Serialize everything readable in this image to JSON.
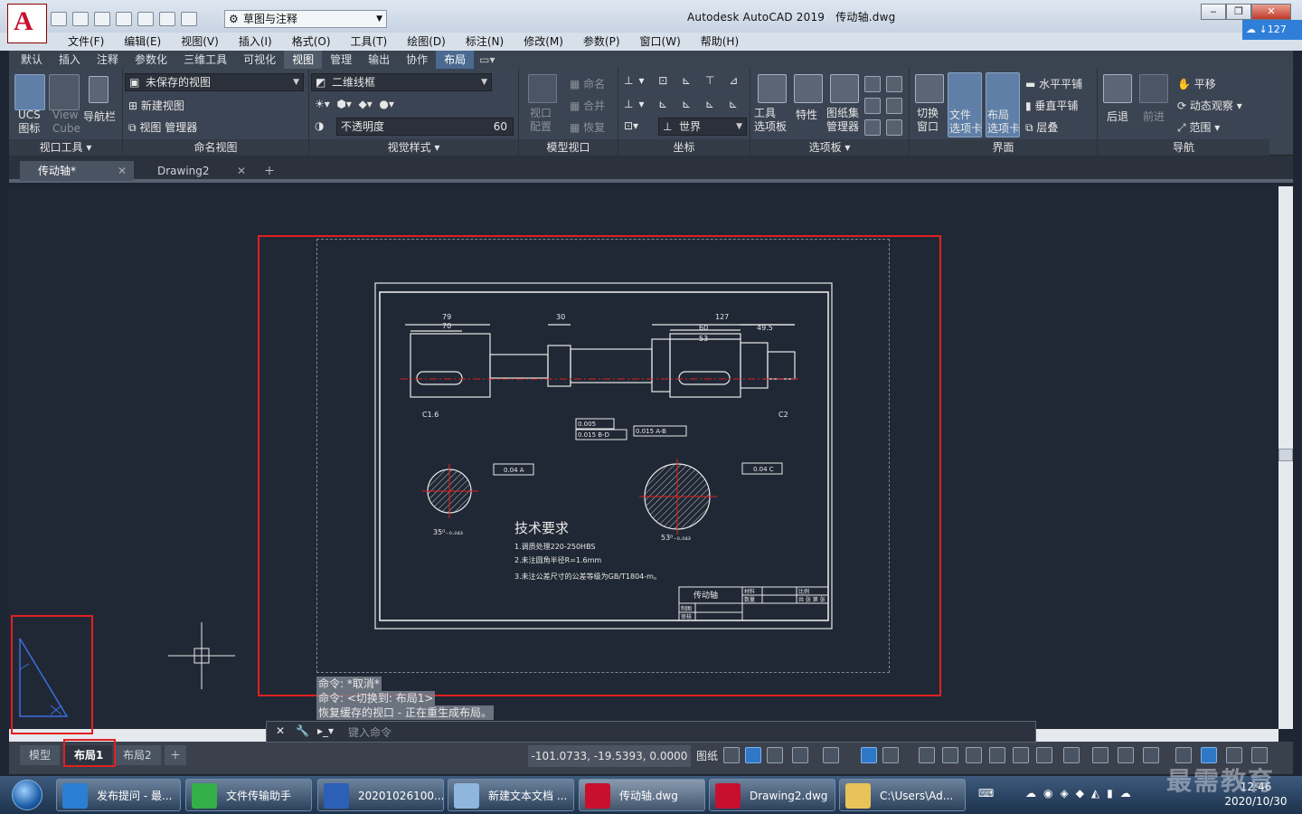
{
  "app": {
    "title": "Autodesk AutoCAD 2019",
    "filename": "传动轴.dwg",
    "workspace": "草图与注释",
    "cloud_badge": "127"
  },
  "menus": [
    "文件(F)",
    "编辑(E)",
    "视图(V)",
    "插入(I)",
    "格式(O)",
    "工具(T)",
    "绘图(D)",
    "标注(N)",
    "修改(M)",
    "参数(P)",
    "窗口(W)",
    "帮助(H)"
  ],
  "ribbon_tabs": [
    "默认",
    "插入",
    "注释",
    "参数化",
    "三维工具",
    "可视化",
    "视图",
    "管理",
    "输出",
    "协作",
    "布局"
  ],
  "ribbon": {
    "viewport_tools": {
      "label": "视口工具",
      "ucs": "UCS\n图标",
      "viewcube": "View\nCube",
      "navbar": "导航栏"
    },
    "named_views": {
      "label": "命名视图",
      "dropdown": "未保存的视图",
      "new_view": "新建视图",
      "view_manager": "视图 管理器"
    },
    "visual_styles": {
      "label": "视觉样式",
      "dropdown": "二维线框",
      "opacity_placeholder": "不透明度",
      "opacity_value": "60"
    },
    "model_viewports": {
      "label": "模型视口",
      "config": "视口\n配置",
      "name": "命名",
      "join": "合并",
      "restore": "恢复"
    },
    "coordinates": {
      "label": "坐标",
      "world": "世界"
    },
    "palettes": {
      "label": "选项板",
      "tool": "工具\n选项板",
      "properties": "特性",
      "sheetset": "图纸集\n管理器"
    },
    "interface": {
      "label": "界面",
      "switch": "切换\n窗口",
      "file_tabs": "文件\n选项卡",
      "layout_tabs": "布局\n选项卡",
      "tile_h": "水平平铺",
      "tile_v": "垂直平铺",
      "cascade": "层叠"
    },
    "navigate": {
      "label": "导航",
      "back": "后退",
      "forward": "前进",
      "pan": "平移",
      "orbit": "动态观察",
      "extents": "范围"
    }
  },
  "doc_tabs": [
    {
      "label": "传动轴*",
      "active": true
    },
    {
      "label": "Drawing2",
      "active": false
    }
  ],
  "drawing": {
    "dims": [
      "79",
      "70",
      "30",
      "127",
      "60",
      "49.5",
      "53",
      "C1.6",
      "C2"
    ],
    "tech_title": "技术要求",
    "tech_lines": [
      "1.调质处理220-250HBS",
      "2.未注圆角半径R=1.6mm",
      "3.未注公差尺寸的公差等级为GB/T1804-m。"
    ],
    "title_block_name": "传动轴",
    "tol_labels": [
      "0.005",
      "0.015 B-D",
      "0.015 A-B",
      "0.04 A",
      "0.04 C"
    ],
    "section_dims": [
      "35⁰₋₀.₀₄₃",
      "53⁰₋₀.₀₄₃"
    ],
    "tb_cells": [
      "材料",
      "比例",
      "数量",
      "共 张 第 张",
      "制图",
      "审核"
    ]
  },
  "command": {
    "history": [
      "命令: *取消*",
      "命令: <切换到: 布局1>",
      "恢复缓存的视口 - 正在重生成布局。"
    ],
    "placeholder": "键入命令"
  },
  "layout_tabs": [
    {
      "label": "模型",
      "active": false
    },
    {
      "label": "布局1",
      "active": true
    },
    {
      "label": "布局2",
      "active": false
    }
  ],
  "status": {
    "coords": "-101.0733, -19.5393, 0.0000",
    "paper": "图纸"
  },
  "taskbar": {
    "items": [
      "发布提问 - 最...",
      "文件传输助手",
      "20201026100...",
      "新建文本文档 ...",
      "传动轴.dwg",
      "Drawing2.dwg",
      "C:\\Users\\Ad..."
    ],
    "time": "12:46",
    "date": "2020/10/30"
  },
  "watermark": "最需教育"
}
